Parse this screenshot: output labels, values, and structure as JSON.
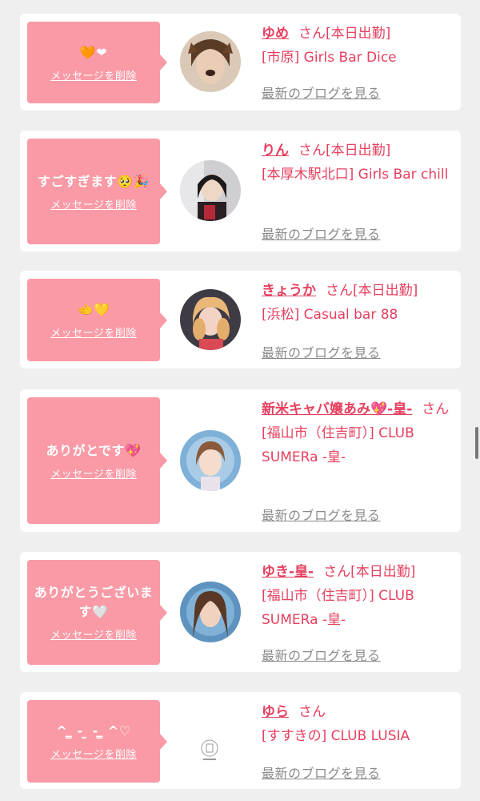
{
  "entries": [
    {
      "message": "🧡❤",
      "delete_label": "メッセージを削除",
      "name": "ゆめ",
      "honorific": "さん",
      "status": "[本日出勤]",
      "shop": "[市原] Girls Bar Dice",
      "blog_link": "最新のブログを見る",
      "avatar": "photo"
    },
    {
      "message": "すごすぎます🥺🎉",
      "delete_label": "メッセージを削除",
      "name": "りん",
      "honorific": "さん",
      "status": "[本日出勤]",
      "shop": "[本厚木駅北口] Girls Bar chill",
      "blog_link": "最新のブログを見る",
      "avatar": "photo"
    },
    {
      "message": "🫲💛",
      "delete_label": "メッセージを削除",
      "name": "きょうか",
      "honorific": "さん",
      "status": "[本日出勤]",
      "shop": "[浜松] Casual bar 88",
      "blog_link": "最新のブログを見る",
      "avatar": "photo"
    },
    {
      "message": "ありがとです💖",
      "delete_label": "メッセージを削除",
      "name": "新米キャバ嬢あみ💖-皇-",
      "honorific": "さん",
      "status": "",
      "shop": "[福山市（住吉町）] CLUB SUMERa -皇-",
      "blog_link": "最新のブログを見る",
      "avatar": "photo"
    },
    {
      "message": "ありがとうございます🤍",
      "delete_label": "メッセージを削除",
      "name": "ゆき-皇-",
      "honorific": "さん",
      "status": "[本日出勤]",
      "shop": "[福山市（住吉町）] CLUB SUMERa -皇-",
      "blog_link": "最新のブログを見る",
      "avatar": "photo"
    },
    {
      "message": "^ ̳ - ̫ - ̳ ^♡",
      "delete_label": "メッセージを削除",
      "name": "ゆら",
      "honorific": "さん",
      "status": "",
      "shop": "[すすきの] CLUB LUSIA",
      "blog_link": "最新のブログを見る",
      "avatar": "logo"
    }
  ],
  "colors": {
    "accent": "#e6405f",
    "bubble": "#f99aa6",
    "link_gray": "#8a8a8a",
    "background": "#efefef"
  }
}
